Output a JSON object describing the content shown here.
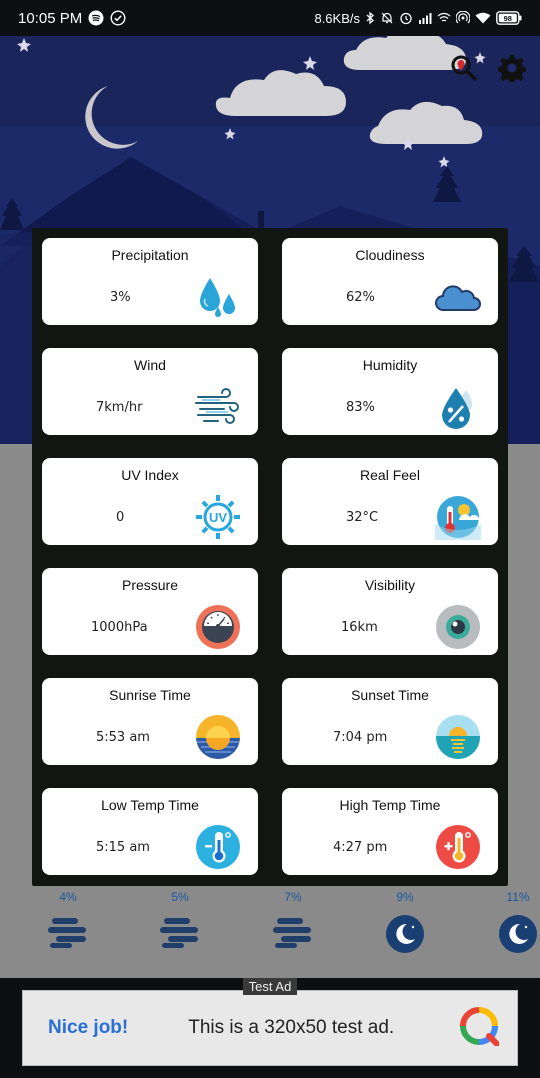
{
  "status_bar": {
    "time": "10:05 PM",
    "net_speed": "8.6KB/s",
    "battery": "98"
  },
  "header": {
    "search_location_icon": "location-search-icon",
    "settings_icon": "gear-icon"
  },
  "details": [
    {
      "title": "Precipitation",
      "value": "3%",
      "icon": "water-drops-icon"
    },
    {
      "title": "Cloudiness",
      "value": "62%",
      "icon": "cloud-icon"
    },
    {
      "title": "Wind",
      "value": "7km/hr",
      "icon": "wind-icon"
    },
    {
      "title": "Humidity",
      "value": "83%",
      "icon": "humidity-drop-icon"
    },
    {
      "title": "UV Index",
      "value": "0",
      "icon": "uv-sun-icon"
    },
    {
      "title": "Real Feel",
      "value": "32°C",
      "icon": "thermometer-sun-icon"
    },
    {
      "title": "Pressure",
      "value": "1000hPa",
      "icon": "pressure-gauge-icon"
    },
    {
      "title": "Visibility",
      "value": "16km",
      "icon": "eye-icon"
    },
    {
      "title": "Sunrise Time",
      "value": "5:53 am",
      "icon": "sunrise-icon"
    },
    {
      "title": "Sunset Time",
      "value": "7:04 pm",
      "icon": "sunset-icon"
    },
    {
      "title": "Low Temp Time",
      "value": "5:15 am",
      "icon": "low-temp-icon"
    },
    {
      "title": "High Temp Time",
      "value": "4:27 pm",
      "icon": "high-temp-icon"
    }
  ],
  "hourly": [
    {
      "precip": "4%",
      "icon": "fog-icon"
    },
    {
      "precip": "5%",
      "icon": "fog-icon"
    },
    {
      "precip": "7%",
      "icon": "fog-icon"
    },
    {
      "precip": "9%",
      "icon": "moon-icon"
    },
    {
      "precip": "11%",
      "icon": "moon-icon"
    }
  ],
  "ad": {
    "tag": "Test Ad",
    "headline": "Nice job!",
    "body": "This is a 320x50 test ad."
  },
  "colors": {
    "dialog_bg": "#111612",
    "card_bg": "#ffffff",
    "night_sky": "#1c2a6b",
    "accent_blue": "#2aa5d8"
  }
}
